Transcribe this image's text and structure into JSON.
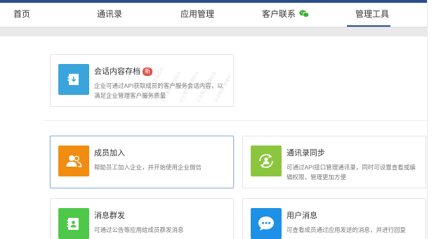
{
  "nav": {
    "tabs": [
      {
        "label": "首页"
      },
      {
        "label": "通讯录"
      },
      {
        "label": "应用管理"
      },
      {
        "label": "客户联系"
      },
      {
        "label": "管理工具"
      }
    ],
    "active_tab": "管理工具"
  },
  "cards": {
    "archive": {
      "title": "会话内容存档",
      "badge": "新",
      "desc": "企业可通过API获取成员的客户服务会话内容，以满足企业管理客户服务质量",
      "icon": "archive-download-icon",
      "color": "#3aa5dd"
    },
    "join": {
      "title": "成员加入",
      "desc": "帮助员工加入企业，并开始使用企业微信",
      "icon": "people-icon",
      "color": "#f08c10"
    },
    "sync": {
      "title": "通讯录同步",
      "desc": "可通过API接口管理通讯录，同时可设置查看或编辑权限，管理更加方便",
      "icon": "sync-user-icon",
      "color": "#8cc63e"
    },
    "broadcast": {
      "title": "消息群发",
      "desc": "可通过公告等应用给成员群发消息",
      "icon": "contact-card-icon",
      "color": "#4fc84a"
    },
    "usermsg": {
      "title": "用户消息",
      "desc": "可查看成员通过应用发送的消息，并进行回复",
      "icon": "chat-bubble-icon",
      "color": "#1e90e8"
    }
  },
  "colors": {
    "accent": "#2a4e8a",
    "wechat_green": "#3cb034"
  }
}
